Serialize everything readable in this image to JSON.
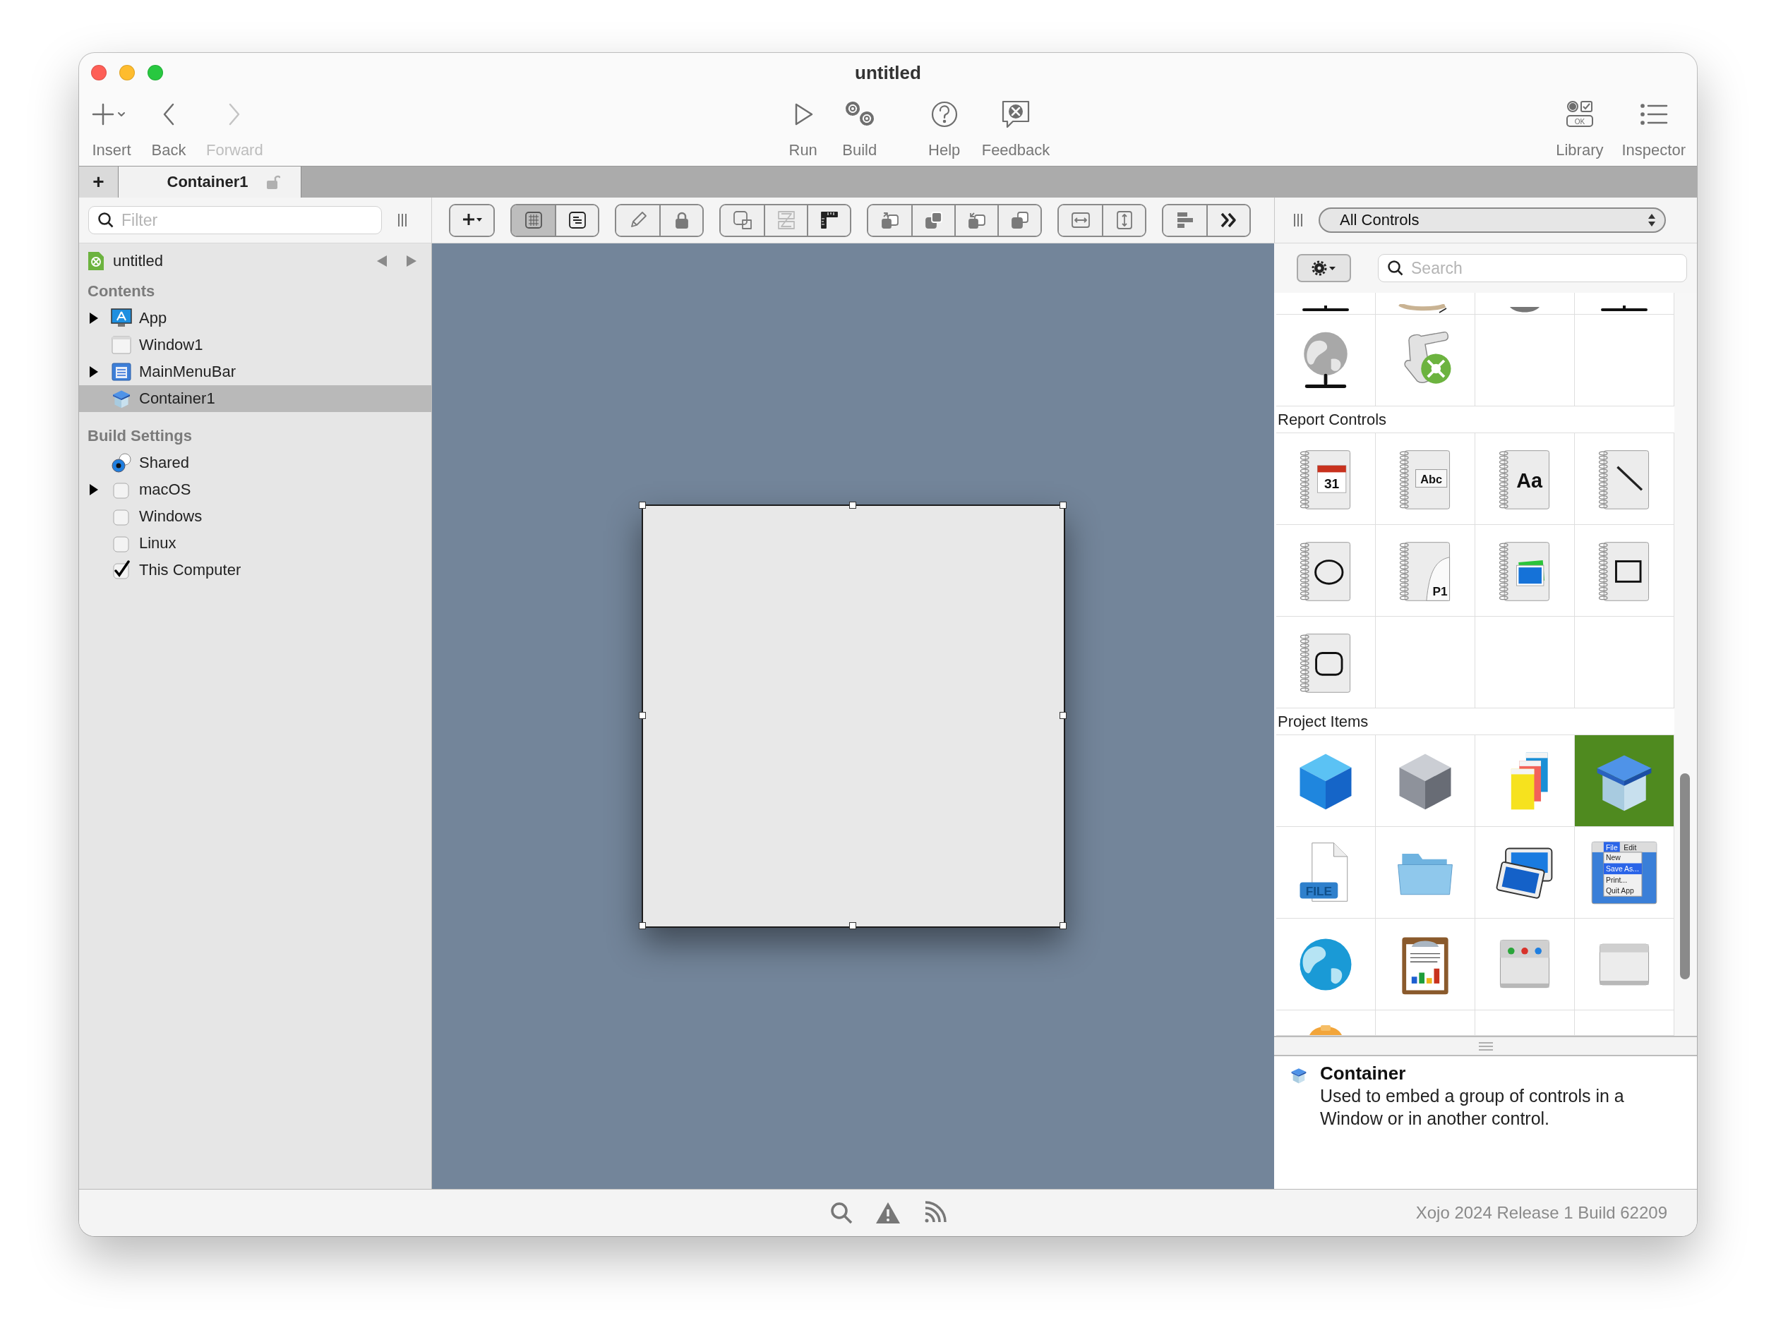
{
  "window": {
    "title": "untitled"
  },
  "toolbar": {
    "left": [
      {
        "kind": "insert",
        "label": "Insert",
        "disabled": false
      },
      {
        "kind": "back",
        "label": "Back",
        "disabled": false
      },
      {
        "kind": "forward",
        "label": "Forward",
        "disabled": true
      }
    ],
    "center": [
      {
        "kind": "run",
        "label": "Run",
        "disabled": false
      },
      {
        "kind": "build",
        "label": "Build",
        "disabled": false
      },
      {
        "kind": "help",
        "label": "Help",
        "disabled": false
      },
      {
        "kind": "feedback",
        "label": "Feedback",
        "disabled": false
      }
    ],
    "right": [
      {
        "kind": "library",
        "label": "Library",
        "disabled": false,
        "icon_text": "OK"
      },
      {
        "kind": "inspector",
        "label": "Inspector",
        "disabled": false
      }
    ]
  },
  "new_tab_button": {
    "label": "+"
  },
  "tabs": [
    {
      "label": "Container1",
      "selected": true
    }
  ],
  "navigator": {
    "filter_placeholder": "Filter",
    "project": "untitled",
    "sections": [
      {
        "title": "Contents",
        "items": [
          {
            "kind": "app",
            "label": "App",
            "expandable": true,
            "selected": false
          },
          {
            "kind": "window",
            "label": "Window1",
            "expandable": false,
            "selected": false
          },
          {
            "kind": "menubar",
            "label": "MainMenuBar",
            "expandable": true,
            "selected": false
          },
          {
            "kind": "container",
            "label": "Container1",
            "expandable": false,
            "selected": true
          }
        ]
      },
      {
        "title": "Build Settings",
        "items": [
          {
            "kind": "radio",
            "label": "Shared",
            "checked": true,
            "expandable": false,
            "selected": false
          },
          {
            "kind": "checkbox",
            "label": "macOS",
            "checked": false,
            "expandable": true,
            "selected": false
          },
          {
            "kind": "checkbox",
            "label": "Windows",
            "checked": false,
            "expandable": false,
            "selected": false
          },
          {
            "kind": "checkbox",
            "label": "Linux",
            "checked": false,
            "expandable": false,
            "selected": false
          },
          {
            "kind": "checkbox",
            "label": "This Computer",
            "checked": true,
            "expandable": false,
            "selected": false
          }
        ]
      }
    ]
  },
  "layout_tools": [
    [
      {
        "kind": "add-menu",
        "selected": false
      }
    ],
    [
      {
        "kind": "grid",
        "selected": true
      },
      {
        "kind": "list",
        "selected": false
      }
    ],
    [
      {
        "kind": "pencil",
        "selected": false
      },
      {
        "kind": "lock",
        "selected": false
      }
    ],
    [
      {
        "kind": "tab-order",
        "selected": false
      },
      {
        "kind": "no-align",
        "selected": false
      },
      {
        "kind": "ruler",
        "selected": false
      }
    ],
    [
      {
        "kind": "front-step",
        "selected": false
      },
      {
        "kind": "front",
        "selected": false
      },
      {
        "kind": "back-step",
        "selected": false
      },
      {
        "kind": "back",
        "selected": false
      }
    ],
    [
      {
        "kind": "width",
        "selected": false
      },
      {
        "kind": "height",
        "selected": false
      }
    ],
    [
      {
        "kind": "align-left",
        "selected": false
      },
      {
        "kind": "more",
        "selected": false
      }
    ]
  ],
  "library": {
    "filter": "All Controls",
    "search_placeholder": "Search",
    "sections": [
      {
        "items": [
          {
            "kind": "partial-stand",
            "selected": false
          },
          {
            "kind": "partial-disc",
            "selected": false
          },
          {
            "kind": "partial-dome",
            "selected": false
          },
          {
            "kind": "partial-stand",
            "selected": false
          }
        ]
      },
      {
        "items": [
          {
            "kind": "globe-server",
            "selected": false
          },
          {
            "kind": "scroll",
            "selected": false
          }
        ]
      },
      {
        "title": "Report Controls",
        "items": [
          {
            "kind": "date",
            "text": "31",
            "selected": false
          },
          {
            "kind": "text-field",
            "text": "Abc",
            "selected": false
          },
          {
            "kind": "label",
            "text": "Aa",
            "selected": false
          },
          {
            "kind": "line",
            "selected": false
          },
          {
            "kind": "oval",
            "selected": false
          },
          {
            "kind": "page-number",
            "text": "P1",
            "selected": false
          },
          {
            "kind": "picture",
            "selected": false
          },
          {
            "kind": "rectangle",
            "selected": false
          },
          {
            "kind": "round-rectangle",
            "selected": false
          }
        ]
      },
      {
        "title": "Project Items",
        "items": [
          {
            "kind": "class",
            "selected": false
          },
          {
            "kind": "interface",
            "selected": false
          },
          {
            "kind": "sheets",
            "selected": false
          },
          {
            "kind": "container",
            "selected": true
          },
          {
            "kind": "file",
            "text": "FILE",
            "selected": false
          },
          {
            "kind": "folder",
            "selected": false
          },
          {
            "kind": "image-set",
            "selected": false
          },
          {
            "kind": "menu",
            "texts": [
              "File",
              "Edit",
              "New",
              "Save As...",
              "Print...",
              "Quit App"
            ],
            "selected": false
          },
          {
            "kind": "web",
            "selected": false
          },
          {
            "kind": "report",
            "selected": false
          },
          {
            "kind": "toolbar",
            "selected": false
          },
          {
            "kind": "window",
            "selected": false
          },
          {
            "kind": "partial-orange",
            "selected": false
          }
        ]
      }
    ]
  },
  "description": {
    "title": "Container",
    "text": "Used to embed a group of controls in a Window or in another control."
  },
  "status_bar": {
    "version": "Xojo 2024 Release 1 Build 62209"
  }
}
